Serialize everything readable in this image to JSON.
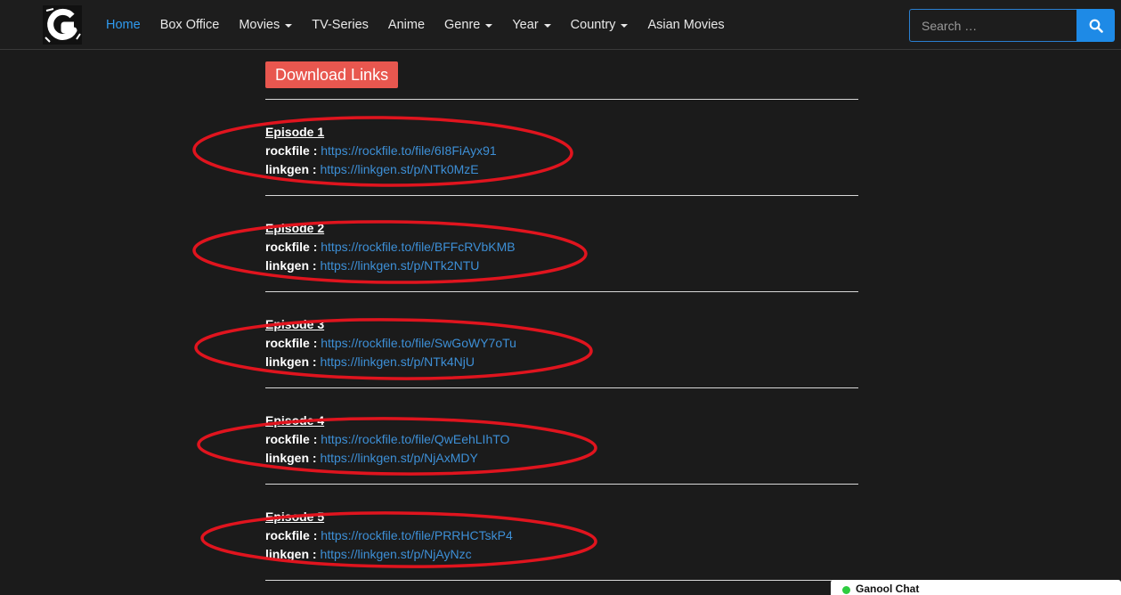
{
  "nav": {
    "items": [
      {
        "label": "Home",
        "dropdown": false,
        "active": true
      },
      {
        "label": "Box Office",
        "dropdown": false,
        "active": false
      },
      {
        "label": "Movies",
        "dropdown": true,
        "active": false
      },
      {
        "label": "TV-Series",
        "dropdown": false,
        "active": false
      },
      {
        "label": "Anime",
        "dropdown": false,
        "active": false
      },
      {
        "label": "Genre",
        "dropdown": true,
        "active": false
      },
      {
        "label": "Year",
        "dropdown": true,
        "active": false
      },
      {
        "label": "Country",
        "dropdown": true,
        "active": false
      },
      {
        "label": "Asian Movies",
        "dropdown": false,
        "active": false
      }
    ],
    "logo_letter": "G"
  },
  "search": {
    "placeholder": "Search …",
    "button_icon": "search-icon"
  },
  "download": {
    "heading": "Download Links",
    "episodes": [
      {
        "title": "Episode 1",
        "links": [
          {
            "label": "rockfile :",
            "url": "https://rockfile.to/file/6I8FiAyx91"
          },
          {
            "label": "linkgen :",
            "url": "https://linkgen.st/p/NTk0MzE"
          }
        ]
      },
      {
        "title": "Episode 2",
        "links": [
          {
            "label": "rockfile :",
            "url": "https://rockfile.to/file/BFFcRVbKMB"
          },
          {
            "label": "linkgen :",
            "url": "https://linkgen.st/p/NTk2NTU"
          }
        ]
      },
      {
        "title": "Episode 3",
        "links": [
          {
            "label": "rockfile :",
            "url": "https://rockfile.to/file/SwGoWY7oTu"
          },
          {
            "label": "linkgen :",
            "url": "https://linkgen.st/p/NTk4NjU"
          }
        ]
      },
      {
        "title": "Episode 4",
        "links": [
          {
            "label": "rockfile :",
            "url": "https://rockfile.to/file/QwEehLIhTO"
          },
          {
            "label": "linkgen :",
            "url": "https://linkgen.st/p/NjAxMDY"
          }
        ]
      },
      {
        "title": "Episode 5",
        "links": [
          {
            "label": "rockfile :",
            "url": "https://rockfile.to/file/PRRHCTskP4"
          },
          {
            "label": "linkgen :",
            "url": "https://linkgen.st/p/NjAyNzc"
          }
        ]
      }
    ]
  },
  "chat": {
    "label": "Ganool Chat",
    "status_color": "#2ecc40"
  },
  "colors": {
    "background": "#1b1b1b",
    "accent": "#2f9bf0",
    "link": "#3d8fd6",
    "badge": "#e8574f",
    "annotation": "#e0141e"
  }
}
